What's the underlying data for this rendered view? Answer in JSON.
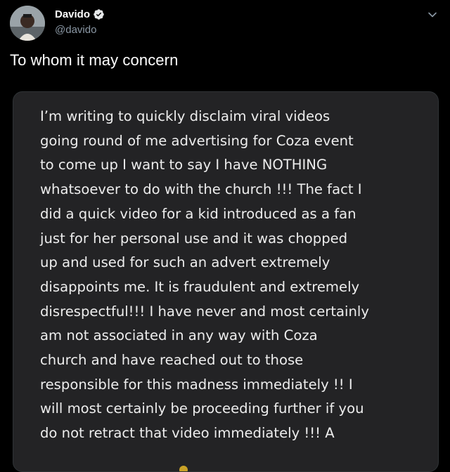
{
  "author": {
    "display_name": "Davido",
    "handle": "@davido",
    "verified_icon": "verified-badge-icon"
  },
  "tweet": {
    "text": "To whom it may concern"
  },
  "media": {
    "statement": "I’m writing to quickly disclaim viral videos\ngoing round of me advertising for Coza event\nto come up I want to say I have NOTHING\nwhatsoever to do with the church !!! The fact I\ndid a quick video for a kid introduced as a fan\njust for her personal use and it was chopped\nup and used for such an advert extremely\ndisappoints me. It is fraudulent and extremely\ndisrespectful!!! I have never and most certainly\nam not associated in any way with Coza\nchurch and have reached out to those\nresponsible for this madness immediately !! I\nwill most certainly be proceeding further if you\ndo not retract that video immediately !!! A"
  },
  "icons": {
    "menu": "chevron-down-icon",
    "avatar": "avatar"
  },
  "colors": {
    "background": "#000000",
    "card": "#232325",
    "verified": "#1d9bf0",
    "handle": "#8b98a5"
  }
}
